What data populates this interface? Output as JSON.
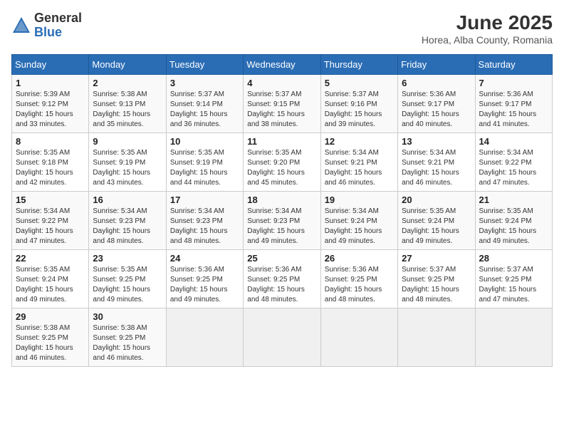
{
  "logo": {
    "general": "General",
    "blue": "Blue"
  },
  "title": {
    "month_year": "June 2025",
    "location": "Horea, Alba County, Romania"
  },
  "days_of_week": [
    "Sunday",
    "Monday",
    "Tuesday",
    "Wednesday",
    "Thursday",
    "Friday",
    "Saturday"
  ],
  "weeks": [
    [
      {
        "day": 1,
        "sunrise": "5:39 AM",
        "sunset": "9:12 PM",
        "daylight": "15 hours and 33 minutes."
      },
      {
        "day": 2,
        "sunrise": "5:38 AM",
        "sunset": "9:13 PM",
        "daylight": "15 hours and 35 minutes."
      },
      {
        "day": 3,
        "sunrise": "5:37 AM",
        "sunset": "9:14 PM",
        "daylight": "15 hours and 36 minutes."
      },
      {
        "day": 4,
        "sunrise": "5:37 AM",
        "sunset": "9:15 PM",
        "daylight": "15 hours and 38 minutes."
      },
      {
        "day": 5,
        "sunrise": "5:37 AM",
        "sunset": "9:16 PM",
        "daylight": "15 hours and 39 minutes."
      },
      {
        "day": 6,
        "sunrise": "5:36 AM",
        "sunset": "9:17 PM",
        "daylight": "15 hours and 40 minutes."
      },
      {
        "day": 7,
        "sunrise": "5:36 AM",
        "sunset": "9:17 PM",
        "daylight": "15 hours and 41 minutes."
      }
    ],
    [
      {
        "day": 8,
        "sunrise": "5:35 AM",
        "sunset": "9:18 PM",
        "daylight": "15 hours and 42 minutes."
      },
      {
        "day": 9,
        "sunrise": "5:35 AM",
        "sunset": "9:19 PM",
        "daylight": "15 hours and 43 minutes."
      },
      {
        "day": 10,
        "sunrise": "5:35 AM",
        "sunset": "9:19 PM",
        "daylight": "15 hours and 44 minutes."
      },
      {
        "day": 11,
        "sunrise": "5:35 AM",
        "sunset": "9:20 PM",
        "daylight": "15 hours and 45 minutes."
      },
      {
        "day": 12,
        "sunrise": "5:34 AM",
        "sunset": "9:21 PM",
        "daylight": "15 hours and 46 minutes."
      },
      {
        "day": 13,
        "sunrise": "5:34 AM",
        "sunset": "9:21 PM",
        "daylight": "15 hours and 46 minutes."
      },
      {
        "day": 14,
        "sunrise": "5:34 AM",
        "sunset": "9:22 PM",
        "daylight": "15 hours and 47 minutes."
      }
    ],
    [
      {
        "day": 15,
        "sunrise": "5:34 AM",
        "sunset": "9:22 PM",
        "daylight": "15 hours and 47 minutes."
      },
      {
        "day": 16,
        "sunrise": "5:34 AM",
        "sunset": "9:23 PM",
        "daylight": "15 hours and 48 minutes."
      },
      {
        "day": 17,
        "sunrise": "5:34 AM",
        "sunset": "9:23 PM",
        "daylight": "15 hours and 48 minutes."
      },
      {
        "day": 18,
        "sunrise": "5:34 AM",
        "sunset": "9:23 PM",
        "daylight": "15 hours and 49 minutes."
      },
      {
        "day": 19,
        "sunrise": "5:34 AM",
        "sunset": "9:24 PM",
        "daylight": "15 hours and 49 minutes."
      },
      {
        "day": 20,
        "sunrise": "5:35 AM",
        "sunset": "9:24 PM",
        "daylight": "15 hours and 49 minutes."
      },
      {
        "day": 21,
        "sunrise": "5:35 AM",
        "sunset": "9:24 PM",
        "daylight": "15 hours and 49 minutes."
      }
    ],
    [
      {
        "day": 22,
        "sunrise": "5:35 AM",
        "sunset": "9:24 PM",
        "daylight": "15 hours and 49 minutes."
      },
      {
        "day": 23,
        "sunrise": "5:35 AM",
        "sunset": "9:25 PM",
        "daylight": "15 hours and 49 minutes."
      },
      {
        "day": 24,
        "sunrise": "5:36 AM",
        "sunset": "9:25 PM",
        "daylight": "15 hours and 49 minutes."
      },
      {
        "day": 25,
        "sunrise": "5:36 AM",
        "sunset": "9:25 PM",
        "daylight": "15 hours and 48 minutes."
      },
      {
        "day": 26,
        "sunrise": "5:36 AM",
        "sunset": "9:25 PM",
        "daylight": "15 hours and 48 minutes."
      },
      {
        "day": 27,
        "sunrise": "5:37 AM",
        "sunset": "9:25 PM",
        "daylight": "15 hours and 48 minutes."
      },
      {
        "day": 28,
        "sunrise": "5:37 AM",
        "sunset": "9:25 PM",
        "daylight": "15 hours and 47 minutes."
      }
    ],
    [
      {
        "day": 29,
        "sunrise": "5:38 AM",
        "sunset": "9:25 PM",
        "daylight": "15 hours and 46 minutes."
      },
      {
        "day": 30,
        "sunrise": "5:38 AM",
        "sunset": "9:25 PM",
        "daylight": "15 hours and 46 minutes."
      },
      null,
      null,
      null,
      null,
      null
    ]
  ]
}
